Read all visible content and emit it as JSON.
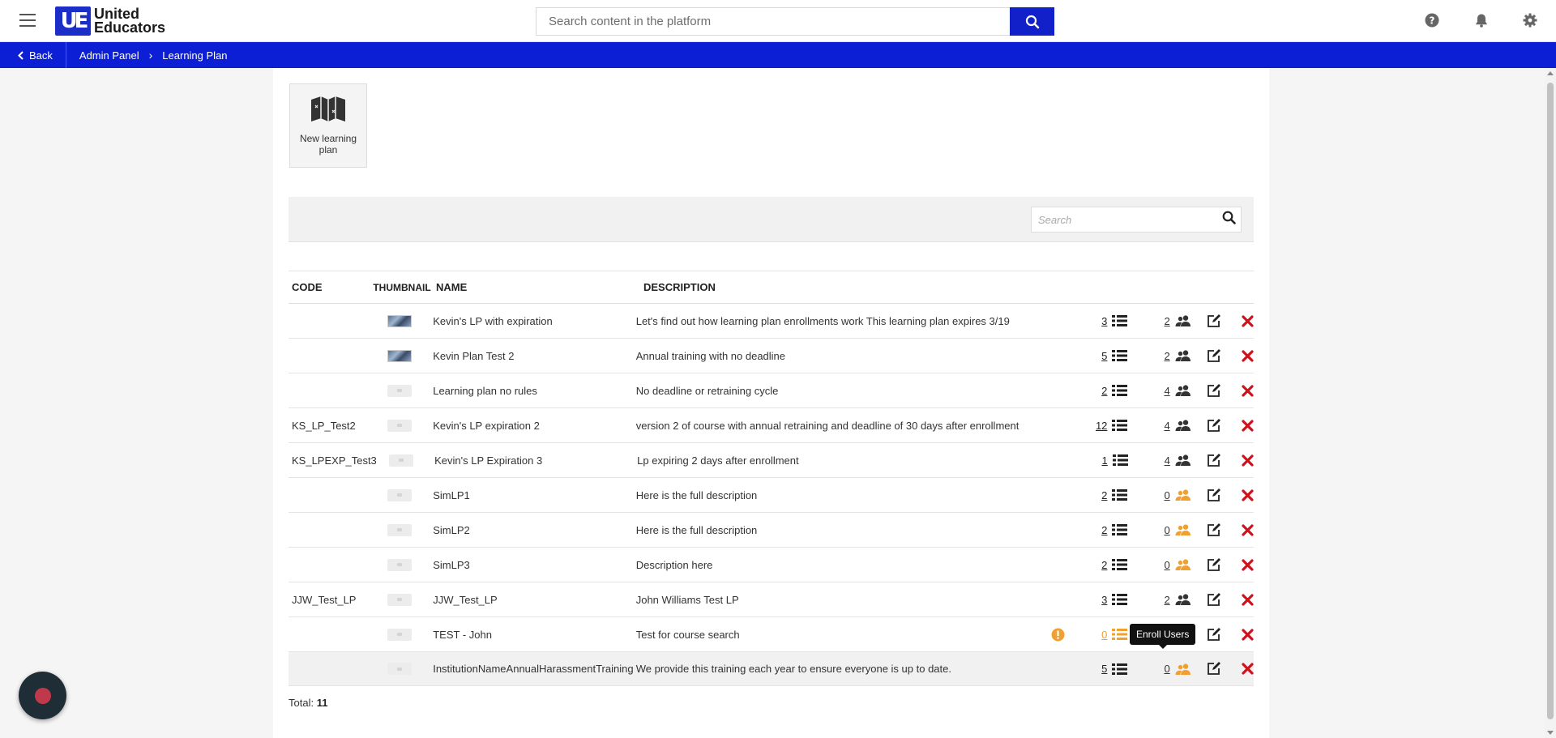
{
  "header": {
    "logo_mark": "UE",
    "logo_line1": "United",
    "logo_line2": "Educators",
    "search_placeholder": "Search content in the platform"
  },
  "breadcrumb": {
    "back": "Back",
    "items": [
      "Admin Panel",
      "Learning Plan"
    ]
  },
  "new_plan": {
    "label_line1": "New learning",
    "label_line2": "plan"
  },
  "filter": {
    "placeholder": "Search"
  },
  "table": {
    "headers": {
      "code": "CODE",
      "thumbnail": "THUMBNAIL",
      "name": "NAME",
      "description": "DESCRIPTION"
    },
    "rows": [
      {
        "code": "",
        "thumb": "image",
        "name": "Kevin's LP with expiration",
        "description": "Let's find out how learning plan enrollments work This learning plan expires 3/19",
        "warning": false,
        "courses": "3",
        "users": "2",
        "users_color": "#333333"
      },
      {
        "code": "",
        "thumb": "image",
        "name": "Kevin Plan Test 2",
        "description": "Annual training with no deadline",
        "warning": false,
        "courses": "5",
        "users": "2",
        "users_color": "#333333"
      },
      {
        "code": "",
        "thumb": "placeholder",
        "name": "Learning plan no rules",
        "description": "No deadline or retraining cycle",
        "warning": false,
        "courses": "2",
        "users": "4",
        "users_color": "#333333"
      },
      {
        "code": "KS_LP_Test2",
        "thumb": "placeholder",
        "name": "Kevin's LP expiration 2",
        "description": "version 2 of course with annual retraining and deadline of 30 days after enrollment",
        "warning": false,
        "courses": "12",
        "users": "4",
        "users_color": "#333333"
      },
      {
        "code": "KS_LPEXP_Test3",
        "thumb": "placeholder",
        "name": "Kevin's LP Expiration 3",
        "description": "Lp expiring 2 days after enrollment",
        "warning": false,
        "courses": "1",
        "users": "4",
        "users_color": "#333333"
      },
      {
        "code": "",
        "thumb": "placeholder",
        "name": "SimLP1",
        "description": "Here is the full description",
        "warning": false,
        "courses": "2",
        "users": "0",
        "users_color": "#f0a030"
      },
      {
        "code": "",
        "thumb": "placeholder",
        "name": "SimLP2",
        "description": "Here is the full description",
        "warning": false,
        "courses": "2",
        "users": "0",
        "users_color": "#f0a030"
      },
      {
        "code": "",
        "thumb": "placeholder",
        "name": "SimLP3",
        "description": "Description here",
        "warning": false,
        "courses": "2",
        "users": "0",
        "users_color": "#f0a030"
      },
      {
        "code": "JJW_Test_LP",
        "thumb": "placeholder",
        "name": "JJW_Test_LP",
        "description": "John Williams Test LP",
        "warning": false,
        "courses": "3",
        "users": "2",
        "users_color": "#333333"
      },
      {
        "code": "",
        "thumb": "placeholder",
        "name": "TEST - John",
        "description": "Test for course search",
        "warning": true,
        "courses": "0",
        "courses_color": "#f0a030",
        "users": "",
        "users_color": "#f0a030"
      },
      {
        "code": "",
        "thumb": "placeholder",
        "name": "InstitutionNameAnnualHarassmentTraining",
        "description": "We provide this training each year to ensure everyone is up to date.",
        "warning": false,
        "courses": "5",
        "users": "0",
        "users_color": "#f0a030"
      }
    ]
  },
  "tooltip": "Enroll Users",
  "total": {
    "label": "Total:",
    "value": "11"
  },
  "colors": {
    "brand_blue": "#0d1fd4",
    "delete_red": "#d0111b",
    "warning_orange": "#f0a030"
  }
}
